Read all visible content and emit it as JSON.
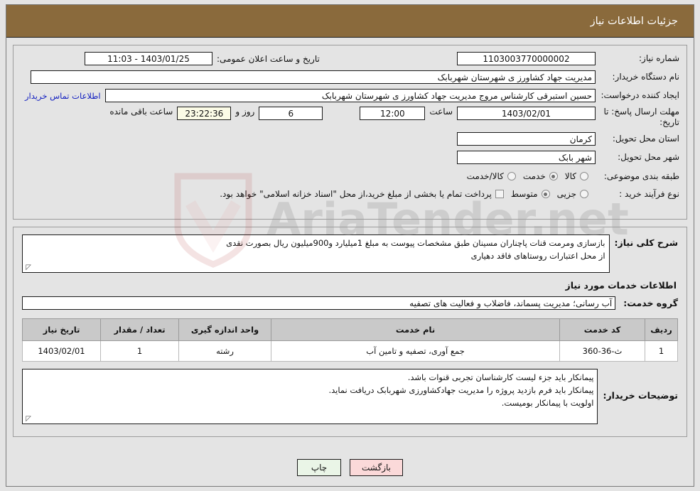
{
  "header": {
    "title": "جزئیات اطلاعات نیاز"
  },
  "fields": {
    "need_number_label": "شماره نیاز:",
    "need_number_value": "1103003770000002",
    "announce_datetime_label": "تاریخ و ساعت اعلان عمومی:",
    "announce_datetime_value": "1403/01/25 - 11:03",
    "buyer_org_label": "نام دستگاه خریدار:",
    "buyer_org_value": "مدیریت جهاد کشاورز ی شهرستان شهربابک",
    "requester_label": "ایجاد کننده درخواست:",
    "requester_value": "حسین استبرقی کارشناس مروج مدیریت جهاد کشاورز ی شهرستان شهربابک",
    "contact_link": "اطلاعات تماس خریدار",
    "deadline_label": "مهلت ارسال پاسخ: تا تاریخ:",
    "deadline_date": "1403/02/01",
    "hour_label": "ساعت",
    "hour_value": "12:00",
    "days_value": "6",
    "days_label": "روز و",
    "countdown_value": "23:22:36",
    "remaining_label": "ساعت باقی مانده",
    "province_label": "استان محل تحویل:",
    "province_value": "کرمان",
    "city_label": "شهر محل تحویل:",
    "city_value": "شهر بابک"
  },
  "classification": {
    "label": "طبقه بندی موضوعی:",
    "options": [
      {
        "label": "کالا",
        "checked": true
      },
      {
        "label": "خدمت",
        "checked": false
      },
      {
        "label": "کالا/خدمت",
        "checked": false
      }
    ]
  },
  "purchase_type": {
    "label": "نوع فرآیند خرید :",
    "options": [
      {
        "label": "جزیی",
        "checked": false
      },
      {
        "label": "متوسط",
        "checked": true
      }
    ],
    "checkbox_label": "پرداخت تمام یا بخشی از مبلغ خرید،از محل \"اسناد خزانه اسلامی\" خواهد بود.",
    "checkbox_checked": false
  },
  "general_description": {
    "label": "شرح کلی نیاز:",
    "lines": [
      "بازسازی ومرمت قنات پاچناران مسینان طبق مشخصات پیوست به مبلغ 1میلیارد و900میلیون ریال بصورت نقدی",
      "از محل اعتبارات روستاهای فاقد دهیاری"
    ]
  },
  "services_section": {
    "heading": "اطلاعات خدمات مورد نیاز",
    "group_label": "گروه خدمت:",
    "group_value": "آب رسانی؛ مدیریت پسماند، فاضلاب و فعالیت های تصفیه"
  },
  "table": {
    "headers": [
      "ردیف",
      "کد خدمت",
      "نام خدمت",
      "واحد اندازه گیری",
      "تعداد / مقدار",
      "تاریخ نیاز"
    ],
    "rows": [
      [
        "1",
        "ث-36-360",
        "جمع آوری، تصفیه و تامین آب",
        "رشته",
        "1",
        "1403/02/01"
      ]
    ]
  },
  "buyer_notes": {
    "label": "توضیحات خریدار:",
    "lines": [
      "پیمانکار باید جزء لیست کارشناسان تجربی قنوات باشد.",
      "پیمانکار باید فرم بازدید پروژه را مدیریت جهادکشاورزی شهربابک دریافت نماید.",
      "اولویت با پیمانکار بومیست."
    ]
  },
  "footer": {
    "print_label": "چاپ",
    "back_label": "بازگشت"
  },
  "colors": {
    "header_bg": "#8a6a3c",
    "page_bg": "#e4e4e4",
    "link": "#1320c0",
    "print_btn": "#eaf5e7",
    "back_btn": "#fbd9d9"
  },
  "watermark": {
    "text": "AriaTender.net"
  }
}
